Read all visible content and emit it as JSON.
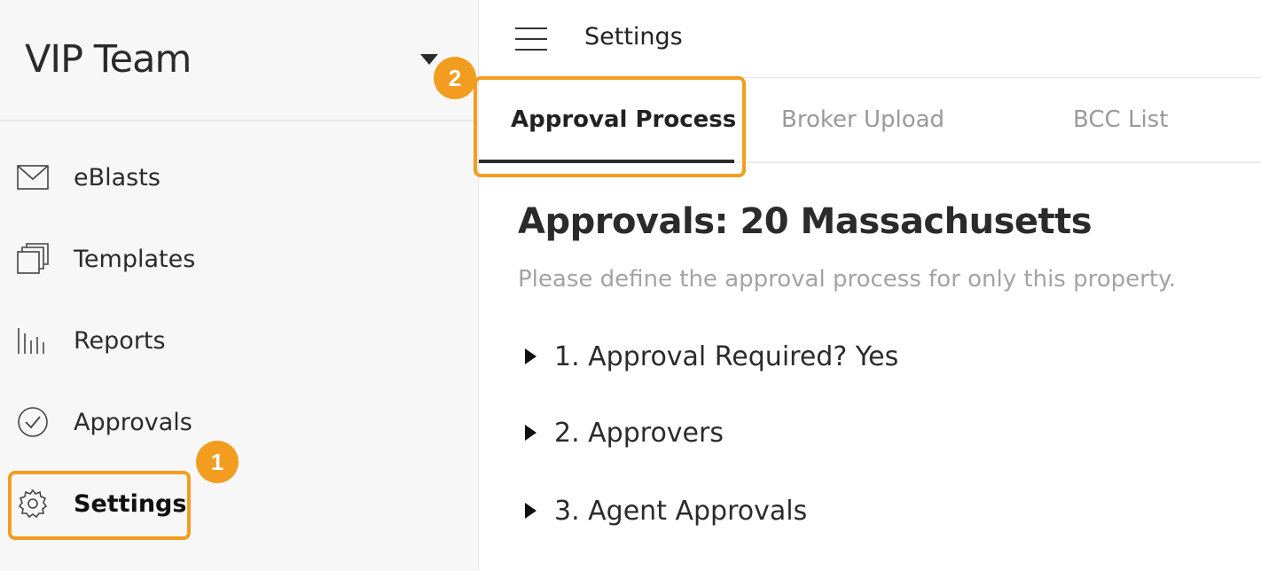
{
  "sidebar": {
    "team_name": "VIP Team",
    "items": [
      {
        "label": "eBlasts",
        "icon": "envelope-icon"
      },
      {
        "label": "Templates",
        "icon": "templates-icon"
      },
      {
        "label": "Reports",
        "icon": "bar-chart-icon"
      },
      {
        "label": "Approvals",
        "icon": "check-circle-icon"
      },
      {
        "label": "Settings",
        "icon": "gear-icon",
        "active": true
      }
    ]
  },
  "header": {
    "title": "Settings"
  },
  "tabs": [
    {
      "label": "Approval Process",
      "active": true
    },
    {
      "label": "Broker Upload"
    },
    {
      "label": "BCC List"
    }
  ],
  "content": {
    "title": "Approvals: 20 Massachusetts",
    "subtitle": "Please define the approval process for only this property.",
    "sections": [
      {
        "label": "1. Approval Required? Yes"
      },
      {
        "label": "2. Approvers"
      },
      {
        "label": "3. Agent Approvals"
      }
    ]
  },
  "annotations": {
    "step1": "1",
    "step2": "2",
    "highlight_color": "#f29d1f"
  }
}
